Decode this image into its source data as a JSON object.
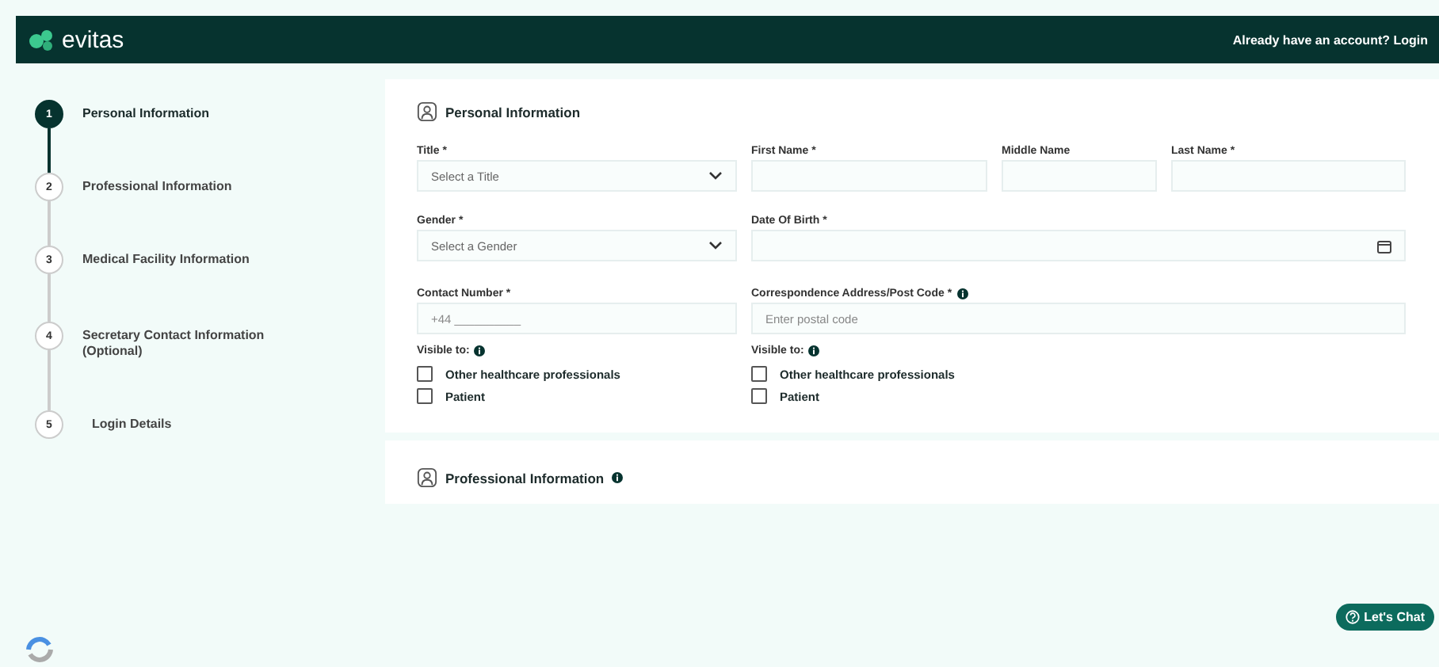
{
  "header": {
    "logo": "evitas",
    "account_prompt": "Already have an account? Login"
  },
  "steps": [
    {
      "number": "1",
      "label": "Personal Information",
      "selected": true
    },
    {
      "number": "2",
      "label": "Professional Information",
      "selected": false
    },
    {
      "number": "3",
      "label": "Medical Facility Information",
      "selected": false
    },
    {
      "number": "4",
      "label": "Secretary Contact Information (Optional)",
      "selected": false
    },
    {
      "number": "5",
      "label": "Login Details",
      "selected": false
    }
  ],
  "personal": {
    "title": "Personal Information",
    "title_field": {
      "label": "Title *",
      "placeholder": "Select a Title"
    },
    "first_name": {
      "label": "First Name *"
    },
    "middle_name": {
      "label": "Middle Name"
    },
    "last_name": {
      "label": "Last Name *"
    },
    "gender": {
      "label": "Gender *",
      "placeholder": "Select a Gender"
    },
    "date_of_birth": {
      "label": "Date Of Birth *"
    },
    "contact": {
      "label": "Contact Number *",
      "placeholder": "+44 __________",
      "visible_label": "Visible to:",
      "options": [
        {
          "label": "Other healthcare professionals",
          "checked": false
        },
        {
          "label": "Patient",
          "checked": false
        }
      ]
    },
    "address": {
      "label": "Correspondence Address/Post Code *",
      "placeholder": "Enter postal code",
      "visible_label": "Visible to:",
      "options": [
        {
          "label": "Other healthcare professionals",
          "checked": false
        },
        {
          "label": "Patient",
          "checked": false
        }
      ]
    }
  },
  "professional": {
    "title": "Professional Information"
  },
  "chat_button": "Let's Chat"
}
